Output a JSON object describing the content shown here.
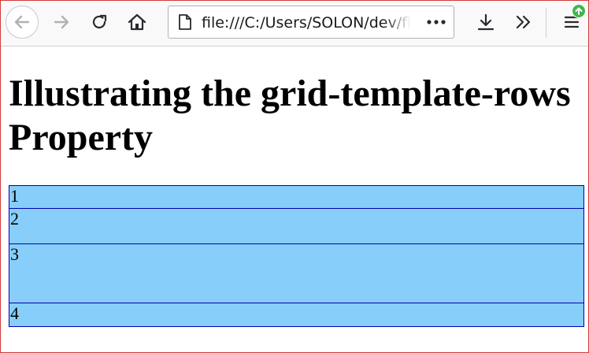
{
  "browser": {
    "url": "file:///C:/Users/SOLON/dev/fla",
    "icons": [
      "back-icon",
      "forward-icon",
      "reload-icon",
      "home-icon",
      "page-icon",
      "more-icon",
      "download-icon",
      "overflow-icon",
      "menu-icon",
      "update-icon"
    ],
    "colors": {
      "frame": "#d23a3a",
      "toolbar": "#f9f9fa",
      "update_badge": "#42b64b"
    }
  },
  "page": {
    "title": "Illustrating the grid-template-rows Property",
    "grid_items": [
      "1",
      "2",
      "3",
      "4"
    ],
    "colors": {
      "item_bg": "#87cefa",
      "item_border": "#0000b0"
    }
  }
}
